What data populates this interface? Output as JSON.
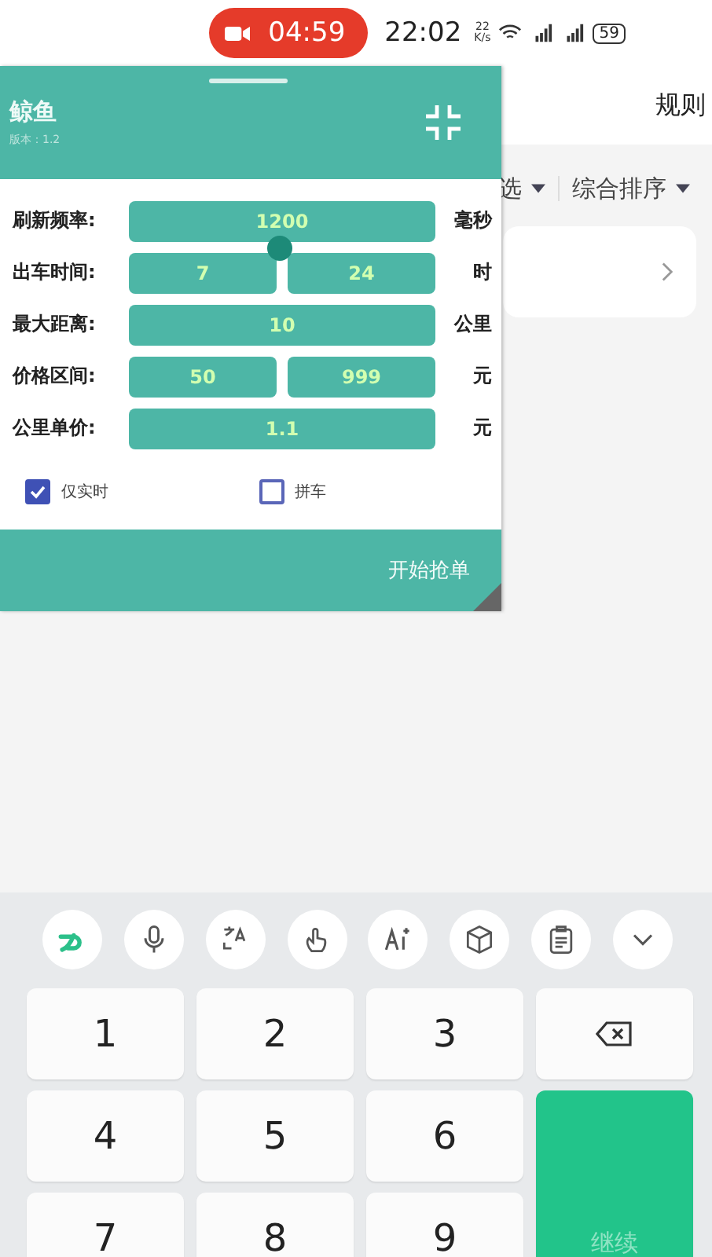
{
  "status_bar": {
    "recording_time": "04:59",
    "time": "22:02",
    "net_speed": "22\nK/s",
    "battery": "59"
  },
  "app": {
    "rule_link": "规则",
    "filters": [
      {
        "label": "选"
      },
      {
        "label": "综合排序"
      }
    ]
  },
  "panel": {
    "title": "鲸鱼",
    "version": "版本：1.2",
    "fields": [
      {
        "label": "刷新频率:",
        "values": [
          "1200"
        ],
        "unit": "毫秒"
      },
      {
        "label": "出车时间:",
        "values": [
          "7",
          "24"
        ],
        "unit": "时"
      },
      {
        "label": "最大距离:",
        "values": [
          "10"
        ],
        "unit": "公里"
      },
      {
        "label": "价格区间:",
        "values": [
          "50",
          "999"
        ],
        "unit": "元"
      },
      {
        "label": "公里单价:",
        "values": [
          "1.1"
        ],
        "unit": "元"
      }
    ],
    "checkboxes": [
      {
        "label": "仅实时",
        "checked": true
      },
      {
        "label": "拼车",
        "checked": false
      }
    ],
    "start_button": "开始抢单"
  },
  "keyboard": {
    "keys": [
      {
        "kind": "digit",
        "label": "1"
      },
      {
        "kind": "digit",
        "label": "2"
      },
      {
        "kind": "digit",
        "label": "3"
      },
      {
        "kind": "backspace"
      },
      {
        "kind": "digit",
        "label": "4"
      },
      {
        "kind": "digit",
        "label": "5"
      },
      {
        "kind": "digit",
        "label": "6"
      },
      {
        "kind": "digit",
        "label": "7"
      },
      {
        "kind": "digit",
        "label": "8"
      },
      {
        "kind": "digit",
        "label": "9"
      },
      {
        "kind": "enter",
        "label": "继续"
      }
    ]
  }
}
